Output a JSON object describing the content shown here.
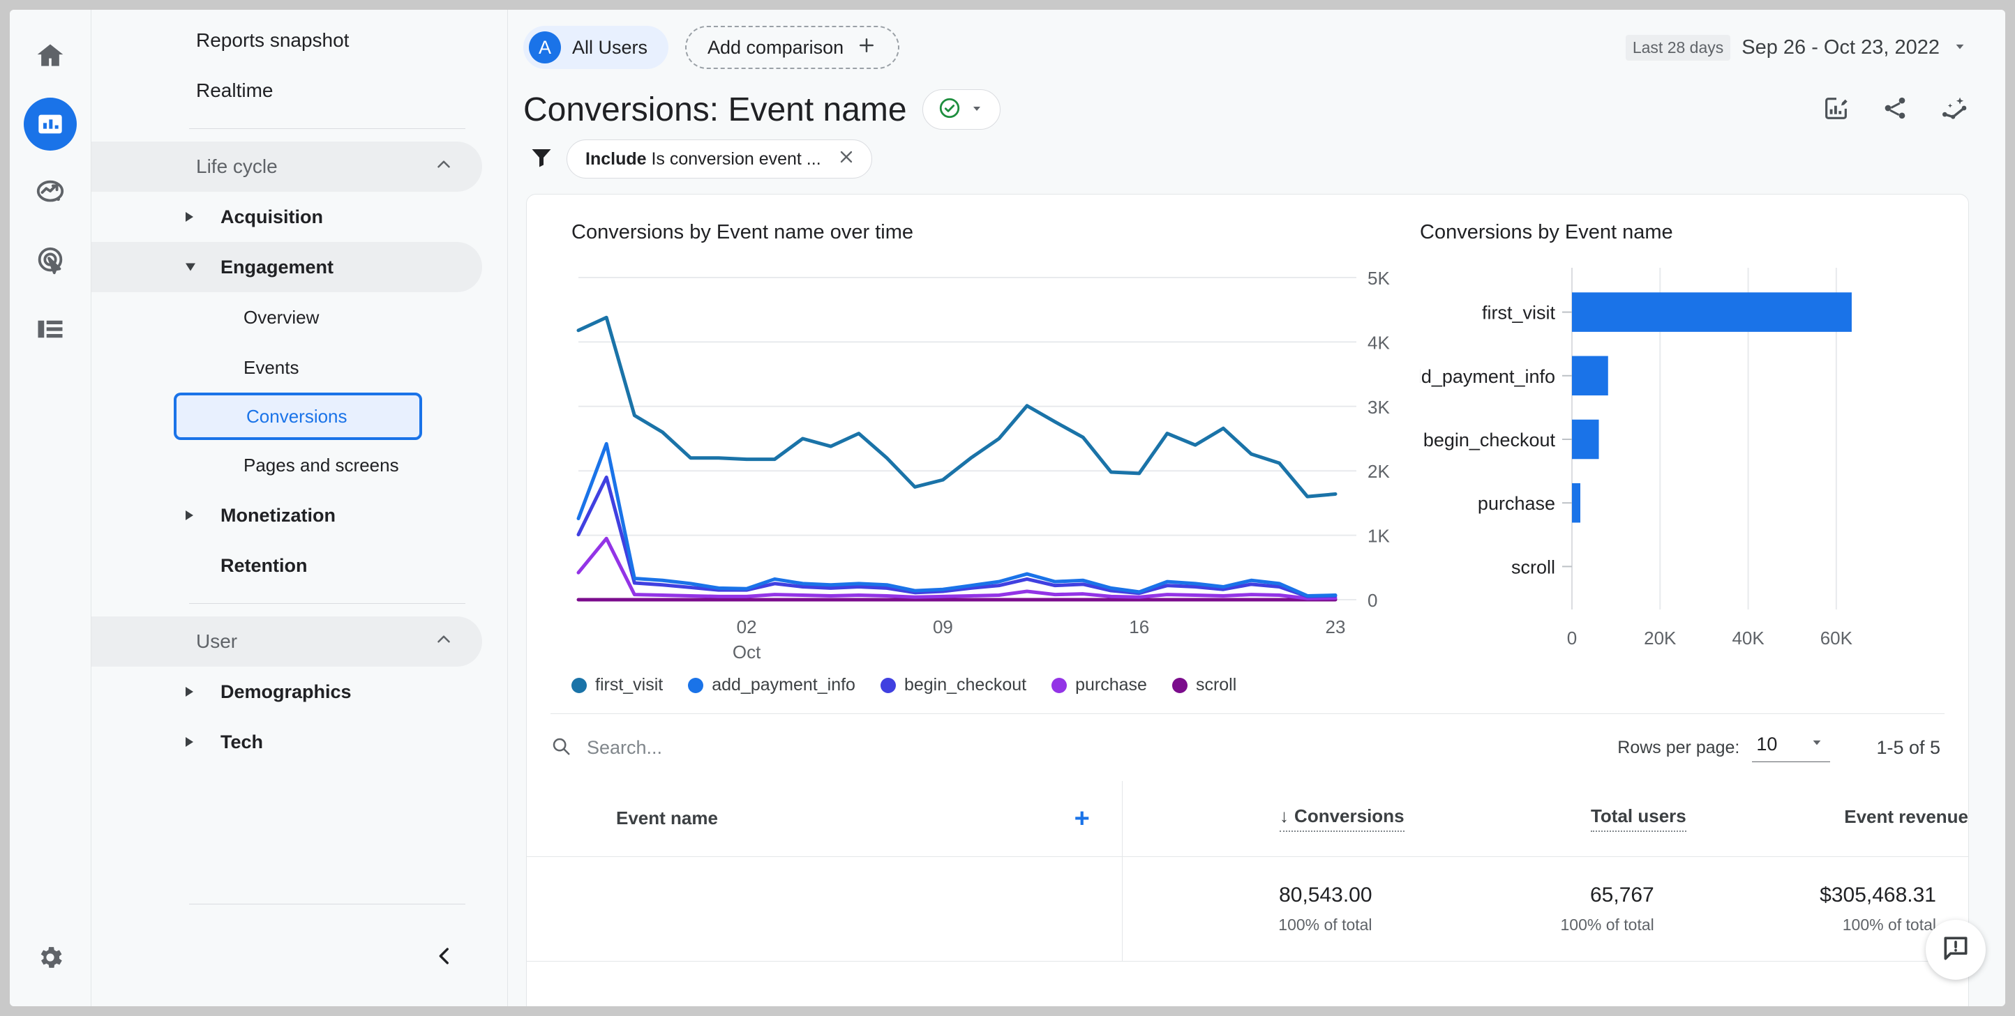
{
  "rail": {
    "items": [
      {
        "name": "home-icon",
        "label": "Home",
        "active": false
      },
      {
        "name": "reports-icon",
        "label": "Reports",
        "active": true
      },
      {
        "name": "explore-icon",
        "label": "Explore",
        "active": false
      },
      {
        "name": "advertising-icon",
        "label": "Advertising",
        "active": false
      },
      {
        "name": "configure-icon",
        "label": "Configure",
        "active": false
      }
    ],
    "settings_label": "Admin"
  },
  "sidebar": {
    "top_items": [
      {
        "label": "Reports snapshot"
      },
      {
        "label": "Realtime"
      }
    ],
    "groups": [
      {
        "label": "Life cycle",
        "items": [
          {
            "label": "Acquisition",
            "type": "expandable",
            "expanded": false
          },
          {
            "label": "Engagement",
            "type": "expandable",
            "expanded": true
          },
          {
            "label": "Overview",
            "type": "sub",
            "selected": false
          },
          {
            "label": "Events",
            "type": "sub",
            "selected": false
          },
          {
            "label": "Conversions",
            "type": "sub",
            "selected": true
          },
          {
            "label": "Pages and screens",
            "type": "sub",
            "selected": false
          },
          {
            "label": "Monetization",
            "type": "expandable",
            "expanded": false
          },
          {
            "label": "Retention",
            "type": "plain",
            "expanded": false
          }
        ]
      },
      {
        "label": "User",
        "items": [
          {
            "label": "Demographics",
            "type": "expandable",
            "expanded": false
          },
          {
            "label": "Tech",
            "type": "expandable",
            "expanded": false
          }
        ]
      }
    ],
    "collapse_label": "Collapse navigation"
  },
  "topbar": {
    "audience_initial": "A",
    "audience_label": "All Users",
    "add_comparison_label": "Add comparison",
    "date_badge": "Last 28 days",
    "date_range": "Sep 26 - Oct 23, 2022"
  },
  "report": {
    "title": "Conversions: Event name",
    "status_icon": "check-circle-icon",
    "filter": {
      "prefix": "Include",
      "text": "Is conversion event ...",
      "remove_label": "×"
    },
    "header_icons": [
      {
        "name": "edit-report-icon",
        "label": "Edit"
      },
      {
        "name": "share-icon",
        "label": "Share this report"
      },
      {
        "name": "insights-icon",
        "label": "Insights"
      }
    ]
  },
  "table": {
    "search_placeholder": "Search...",
    "rows_per_page_label": "Rows per page:",
    "rows_per_page_value": "10",
    "page_range": "1-5 of 5",
    "columns": [
      {
        "label": "Event name",
        "sorted": false
      },
      {
        "label": "Conversions",
        "sorted": true
      },
      {
        "label": "Total users",
        "sorted": false
      },
      {
        "label": "Event revenue",
        "sorted": false
      }
    ],
    "add_dimension_label": "+",
    "totals": {
      "event_name": "",
      "conversions": "80,543.00",
      "conversions_pct": "100% of total",
      "total_users": "65,767",
      "total_users_pct": "100% of total",
      "event_revenue": "$305,468.31",
      "event_revenue_pct": "100% of total"
    }
  },
  "feedback": {
    "label": "Send feedback",
    "icon": "feedback-icon"
  },
  "colors": {
    "accent": "#1a73e8",
    "first_visit": "#1a73a8",
    "add_payment_info": "#1a73e8",
    "begin_checkout": "#4040e0",
    "purchase": "#9334e6",
    "scroll": "#7b0c8c",
    "bar": "#1a73e8",
    "status_green": "#1e8e3e"
  },
  "chart_data": [
    {
      "type": "line",
      "title": "Conversions by Event name over time",
      "xlabel": "",
      "ylabel": "",
      "ylim": [
        0,
        5000
      ],
      "yticks": [
        0,
        1000,
        2000,
        3000,
        4000,
        5000
      ],
      "ytick_labels": [
        "0",
        "1K",
        "2K",
        "3K",
        "4K",
        "5K"
      ],
      "x": [
        "26",
        "27",
        "28",
        "29",
        "30",
        "01",
        "02",
        "03",
        "04",
        "05",
        "06",
        "07",
        "08",
        "09",
        "10",
        "11",
        "12",
        "13",
        "14",
        "15",
        "16",
        "17",
        "18",
        "19",
        "20",
        "21",
        "22",
        "23"
      ],
      "xtick_indices": [
        6,
        13,
        20,
        27
      ],
      "xtick_labels": [
        "02",
        "09",
        "16",
        "23"
      ],
      "xtick_sublabel": "Oct",
      "grid": true,
      "legend_position": "bottom",
      "series": [
        {
          "name": "first_visit",
          "color": "#1a73a8",
          "values": [
            4180,
            4380,
            2860,
            2600,
            2200,
            2200,
            2180,
            2180,
            2500,
            2380,
            2580,
            2200,
            1750,
            1860,
            2200,
            2500,
            3010,
            2760,
            2520,
            1980,
            1960,
            2580,
            2400,
            2660,
            2260,
            2120,
            1600,
            1640
          ]
        },
        {
          "name": "add_payment_info",
          "color": "#1a73e8",
          "values": [
            1260,
            2420,
            330,
            300,
            250,
            180,
            170,
            320,
            250,
            230,
            250,
            230,
            140,
            160,
            220,
            280,
            400,
            280,
            300,
            180,
            120,
            280,
            250,
            200,
            300,
            250,
            60,
            70
          ]
        },
        {
          "name": "begin_checkout",
          "color": "#4040e0",
          "values": [
            1010,
            1900,
            260,
            230,
            190,
            150,
            150,
            250,
            200,
            180,
            200,
            180,
            110,
            130,
            180,
            220,
            320,
            220,
            240,
            140,
            100,
            220,
            200,
            160,
            240,
            200,
            50,
            60
          ]
        },
        {
          "name": "purchase",
          "color": "#9334e6",
          "values": [
            420,
            950,
            80,
            70,
            60,
            50,
            50,
            80,
            70,
            60,
            70,
            60,
            40,
            50,
            60,
            70,
            130,
            80,
            90,
            50,
            40,
            80,
            70,
            60,
            80,
            70,
            20,
            25
          ]
        },
        {
          "name": "scroll",
          "color": "#7b0c8c",
          "values": [
            0,
            0,
            0,
            0,
            0,
            0,
            0,
            0,
            0,
            0,
            0,
            0,
            0,
            0,
            0,
            0,
            0,
            0,
            0,
            0,
            0,
            0,
            0,
            0,
            0,
            0,
            0,
            0
          ]
        }
      ]
    },
    {
      "type": "bar",
      "orientation": "horizontal",
      "title": "Conversions by Event name",
      "categories": [
        "first_visit",
        "add_payment_info",
        "begin_checkout",
        "purchase",
        "scroll"
      ],
      "values": [
        63500,
        8200,
        6100,
        1900,
        0
      ],
      "xlim": [
        0,
        70000
      ],
      "xticks": [
        0,
        20000,
        40000,
        60000
      ],
      "xtick_labels": [
        "0",
        "20K",
        "40K",
        "60K"
      ],
      "color": "#1a73e8",
      "grid": true
    }
  ]
}
